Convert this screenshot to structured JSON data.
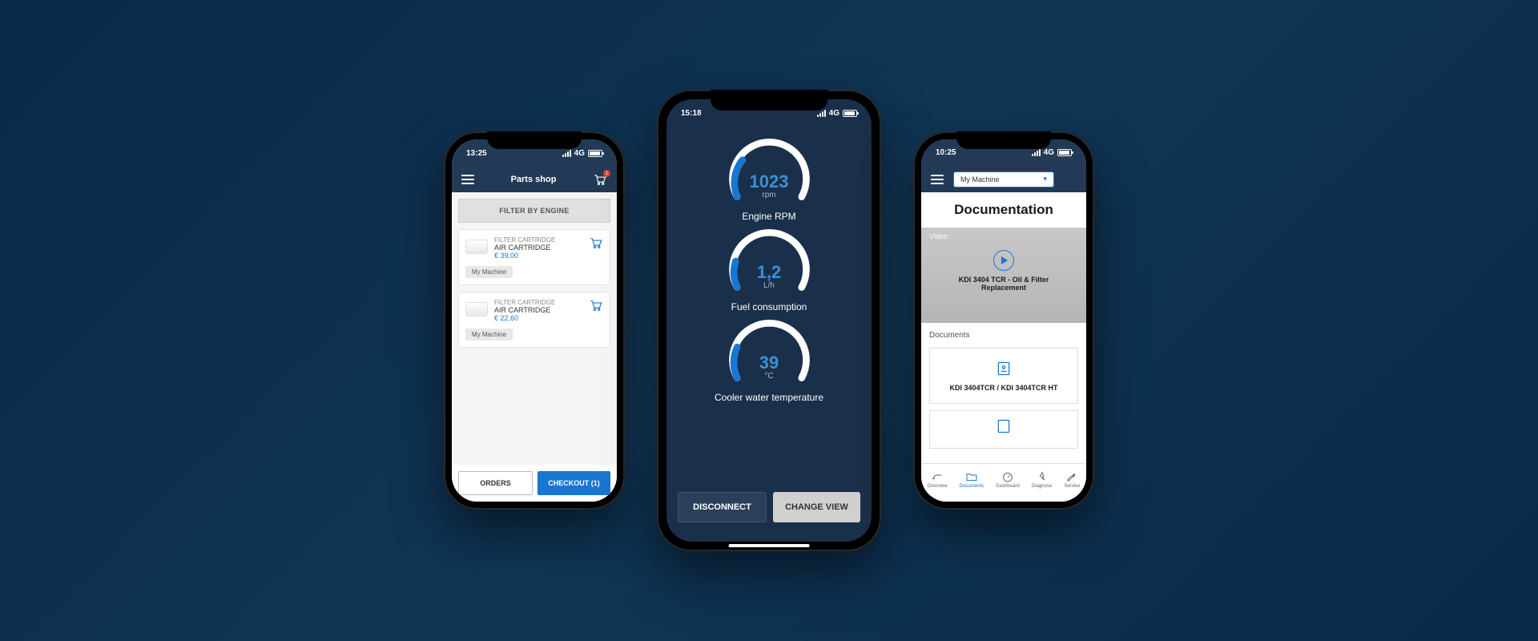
{
  "phone1": {
    "time": "13:25",
    "signal_text": "4G",
    "nav_title": "Parts shop",
    "cart_badge": "1",
    "filter_label": "FILTER BY ENGINE",
    "items": [
      {
        "category": "FILTER CARTRIDGE",
        "name": "AIR CARTRIDGE",
        "price": "€ 39,00",
        "tag": "My Machine"
      },
      {
        "category": "FILTER CARTRIDGE",
        "name": "AIR CARTRIDGE",
        "price": "€ 22,60",
        "tag": "My Machine"
      }
    ],
    "orders_label": "ORDERS",
    "checkout_label": "CHECKOUT (1)"
  },
  "phone2": {
    "time": "15:18",
    "signal_text": "4G",
    "gauges": [
      {
        "value": "1023",
        "unit": "rpm",
        "label": "Engine RPM",
        "fill": 0.35
      },
      {
        "value": "1,2",
        "unit": "L/h",
        "label": "Fuel consumption",
        "fill": 0.22
      },
      {
        "value": "39",
        "unit": "°C",
        "label": "Cooler water temperature",
        "fill": 0.25
      }
    ],
    "disconnect_label": "DISCONNECT",
    "change_view_label": "CHANGE VIEW"
  },
  "phone3": {
    "time": "10:25",
    "signal_text": "4G",
    "dropdown_value": "My Machine",
    "page_title": "Documentation",
    "video_section_label": "Video",
    "video_title": "KDI 3404 TCR - Oil & Filter Replacement",
    "docs_section_label": "Documents",
    "doc_name": "KDI 3404TCR / KDI 3404TCR HT",
    "tabs": [
      {
        "label": "Overview"
      },
      {
        "label": "Documents"
      },
      {
        "label": "Dashboard"
      },
      {
        "label": "Diagnose"
      },
      {
        "label": "Service"
      }
    ],
    "active_tab": 1
  }
}
